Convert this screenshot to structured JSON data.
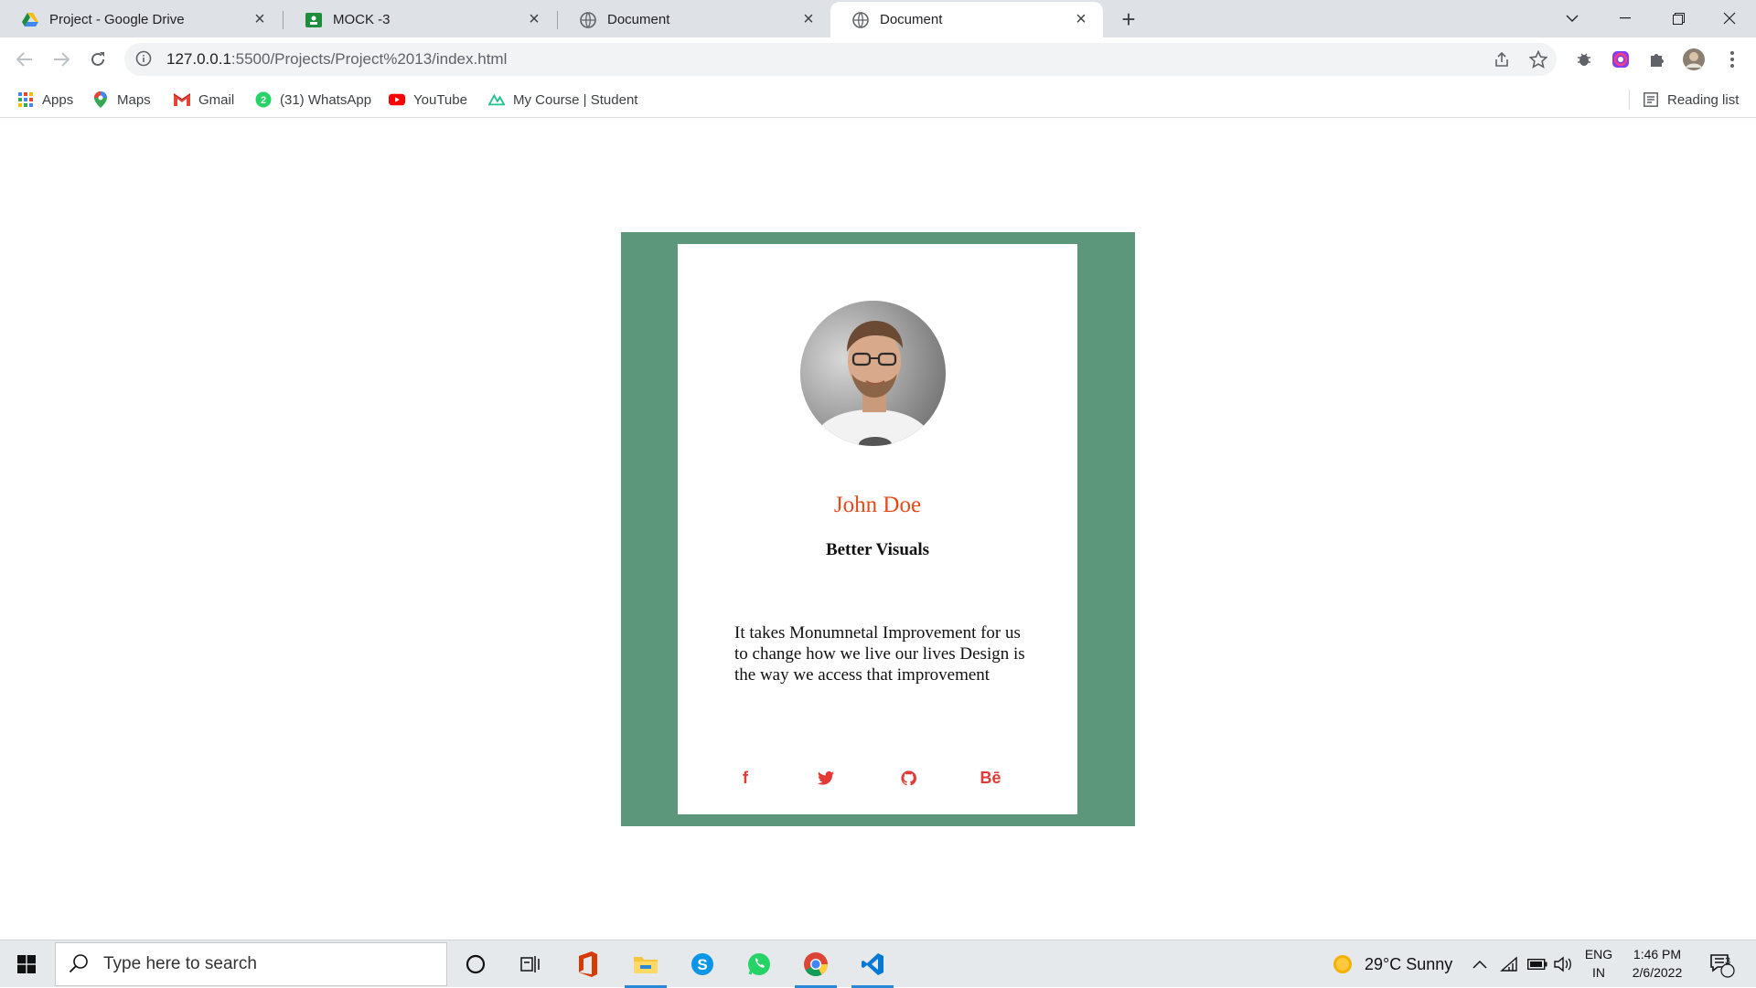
{
  "browser": {
    "tabs": [
      {
        "title": "Project - Google Drive",
        "icon": "google-drive-icon",
        "active": false
      },
      {
        "title": "MOCK -3",
        "icon": "google-classroom-icon",
        "active": false
      },
      {
        "title": "Document",
        "icon": "globe-icon",
        "active": false
      },
      {
        "title": "Document",
        "icon": "globe-icon",
        "active": true
      }
    ],
    "url_host": "127.0.0.1",
    "url_rest": ":5500/Projects/Project%2013/index.html",
    "bookmarks": [
      {
        "label": "Apps",
        "icon": "apps-grid-icon"
      },
      {
        "label": "Maps",
        "icon": "maps-pin-icon"
      },
      {
        "label": "Gmail",
        "icon": "gmail-icon"
      },
      {
        "label": "(31) WhatsApp",
        "icon": "whatsapp-icon"
      },
      {
        "label": "YouTube",
        "icon": "youtube-icon"
      },
      {
        "label": "My Course | Student",
        "icon": "course-icon"
      }
    ],
    "reading_list": "Reading list"
  },
  "card": {
    "name": "John Doe",
    "subtitle": "Better Visuals",
    "description": "It takes Monumnetal Improvement for us to change how we live our lives Design is the way we access that improvement",
    "social": [
      {
        "icon": "facebook-icon",
        "label": "f"
      },
      {
        "icon": "twitter-icon",
        "label": ""
      },
      {
        "icon": "github-icon",
        "label": ""
      },
      {
        "icon": "behance-icon",
        "label": "Bē"
      }
    ],
    "accent_color": "#5c977c",
    "name_color": "#e64a19",
    "icon_color": "#e53935"
  },
  "taskbar": {
    "search_placeholder": "Type here to search",
    "weather": "29°C  Sunny",
    "lang_top": "ENG",
    "lang_bottom": "IN",
    "time": "1:46 PM",
    "date": "2/6/2022",
    "notification_count": "3"
  }
}
